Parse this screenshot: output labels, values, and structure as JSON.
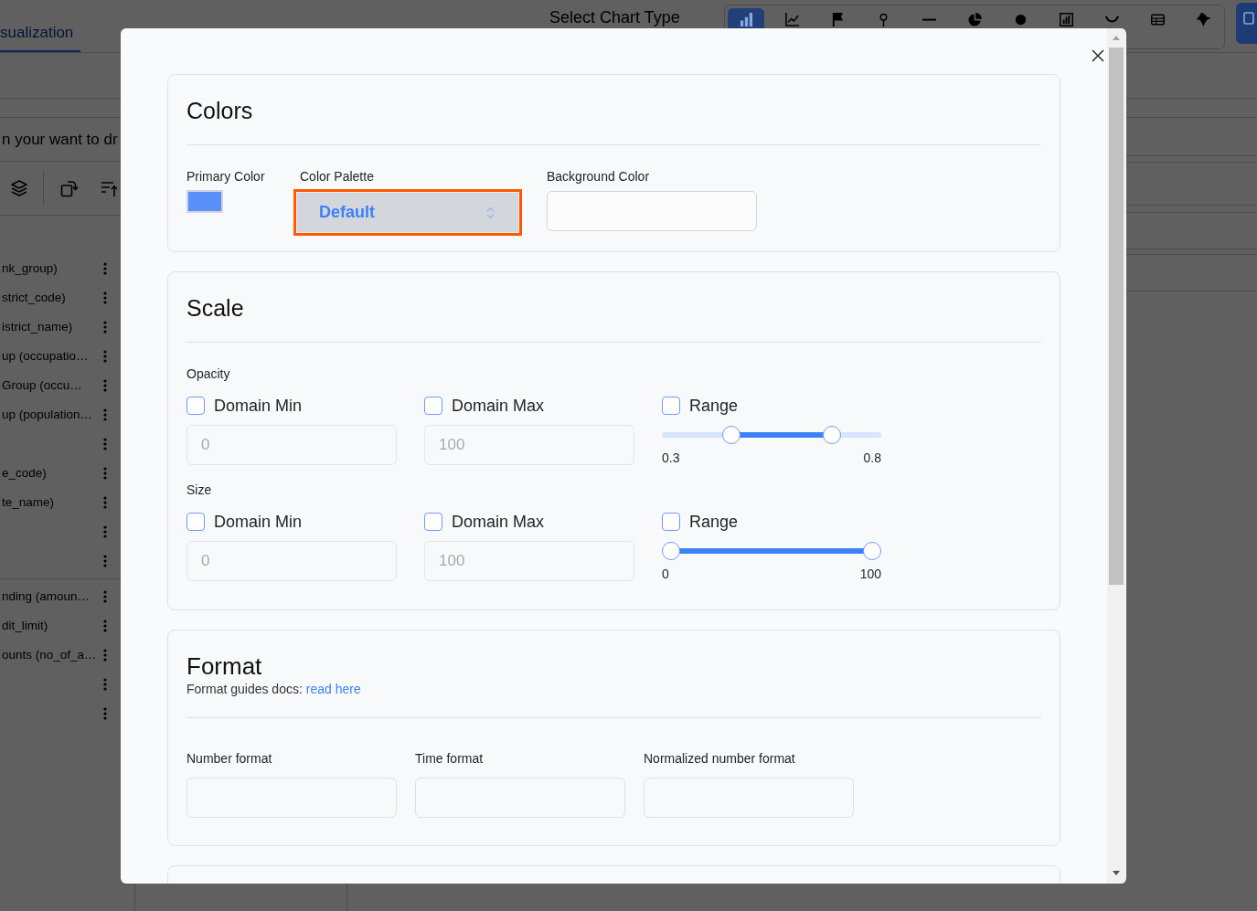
{
  "background": {
    "tab": {
      "label": "sualization",
      "selected": true
    },
    "title": "Select Chart Type",
    "chart_types": [
      {
        "kind": "bar",
        "selected": true
      },
      {
        "kind": "line",
        "selected": false
      },
      {
        "kind": "flag",
        "selected": false
      },
      {
        "kind": "pin",
        "selected": false
      },
      {
        "kind": "dash",
        "selected": false
      },
      {
        "kind": "pie",
        "selected": false
      },
      {
        "kind": "dot",
        "selected": false
      },
      {
        "kind": "column",
        "selected": false
      },
      {
        "kind": "curve",
        "selected": false
      },
      {
        "kind": "table",
        "selected": false
      },
      {
        "kind": "map",
        "selected": false
      }
    ],
    "search": {
      "placeholder": "n your want to dr"
    },
    "field_groups": [
      {
        "items": [
          {
            "label": "nk_group)",
            "menu": true
          },
          {
            "label": "strict_code)",
            "menu": true
          },
          {
            "label": "istrict_name)",
            "menu": true
          },
          {
            "label": "up (occupatio…",
            "menu": true
          },
          {
            "label": "Group (occu…",
            "menu": true
          },
          {
            "label": "up (population…",
            "menu": true
          },
          {
            "menu": true
          },
          {
            "label": "e_code)",
            "menu": true
          },
          {
            "label": "te_name)",
            "menu": true
          },
          {
            "menu": true
          },
          {
            "menu": true
          }
        ]
      },
      {
        "items": [
          {
            "label": "nding (amoun…",
            "menu": true
          },
          {
            "label": "dit_limit)",
            "menu": true
          },
          {
            "label": "ounts (no_of_a…",
            "menu": true
          },
          {
            "menu": true
          },
          {
            "menu": true
          }
        ]
      }
    ]
  },
  "modal": {
    "sections": [
      {
        "kind": "colors",
        "title": "Colors",
        "fields": [
          {
            "kind": "swatch",
            "label": "Primary Color",
            "color": "#5b8ff9"
          },
          {
            "kind": "select",
            "label": "Color Palette",
            "value": "Default",
            "highlighted": true
          },
          {
            "kind": "input",
            "label": "Background Color"
          }
        ]
      },
      {
        "kind": "scale",
        "title": "Scale",
        "groups": [
          {
            "label": "Opacity",
            "controls": [
              {
                "kind": "input",
                "label": "Domain Min",
                "checked": false,
                "placeholder": "0"
              },
              {
                "kind": "input",
                "label": "Domain Max",
                "checked": false,
                "placeholder": "100"
              },
              {
                "kind": "range",
                "label": "Range",
                "checked": false,
                "thumbs": [
                  {
                    "level": 0.3
                  },
                  {
                    "level": 0.8
                  }
                ],
                "min_label": "0.3",
                "max_label": "0.8"
              }
            ]
          },
          {
            "label": "Size",
            "controls": [
              {
                "kind": "input",
                "label": "Domain Min",
                "checked": false,
                "placeholder": "0"
              },
              {
                "kind": "input",
                "label": "Domain Max",
                "checked": false,
                "placeholder": "100"
              },
              {
                "kind": "range",
                "label": "Range",
                "checked": false,
                "thumbs": [
                  {
                    "level": 0
                  },
                  {
                    "level": 1
                  }
                ],
                "min_label": "0",
                "max_label": "100"
              }
            ]
          }
        ]
      },
      {
        "kind": "format",
        "title": "Format",
        "note": "Format guides docs:",
        "link": "read here",
        "fields": [
          {
            "label": "Number format"
          },
          {
            "label": "Time format"
          },
          {
            "label": "Normalized number format"
          }
        ]
      },
      {
        "kind": "partial"
      }
    ]
  }
}
